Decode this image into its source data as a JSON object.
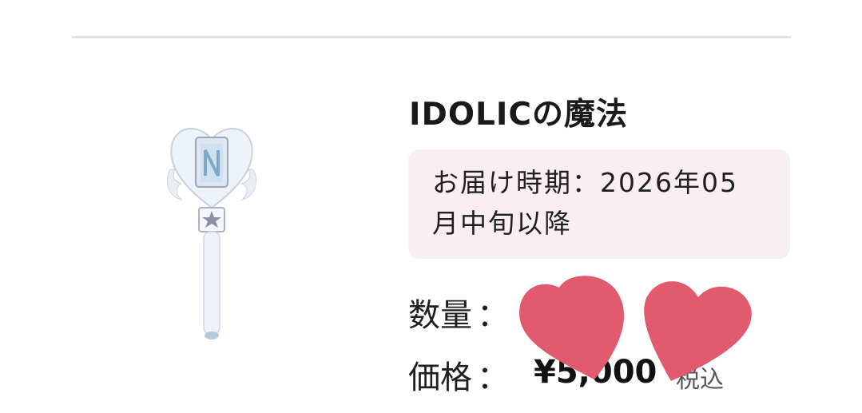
{
  "product": {
    "title": "IDOLICの魔法",
    "delivery_text": "お届け時期：2026年05月中旬以降",
    "quantity_label": "数量",
    "price_label": "価格",
    "separator": "：",
    "price_value": "¥5,000",
    "tax_label": "税込",
    "image_icon": "penlight-icon"
  },
  "colors": {
    "delivery_bg": "#f9eef2",
    "heart": "#e15a6e",
    "divider": "#e0e0e0"
  }
}
